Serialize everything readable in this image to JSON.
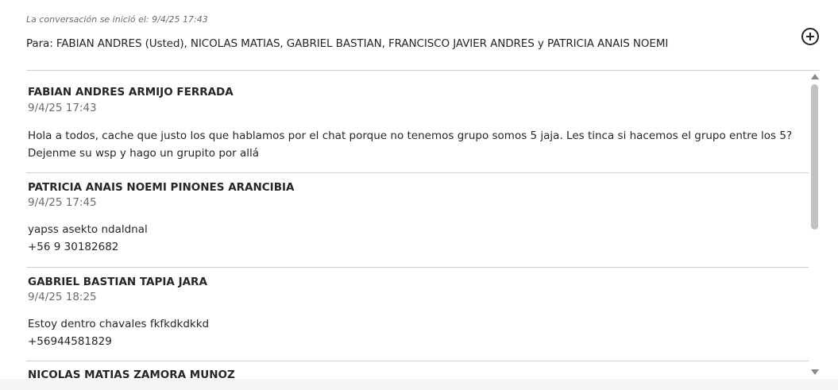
{
  "conversation": {
    "started_label": "La conversación se inició el: 9/4/25 17:43",
    "recipients": "Para: FABIAN ANDRES (Usted), NICOLAS MATIAS, GABRIEL BASTIAN, FRANCISCO JAVIER ANDRES y PATRICIA ANAIS NOEMI",
    "add_icon": "plus-circle-icon"
  },
  "messages": [
    {
      "author": "FABIAN ANDRES ARMIJO FERRADA",
      "time": "9/4/25 17:43",
      "lines": [
        "Hola a todos, cache que justo los que hablamos por el chat porque no tenemos grupo somos 5 jaja. Les tinca si hacemos el grupo entre los 5?",
        "Dejenme su wsp y hago un grupito por allá"
      ]
    },
    {
      "author": "PATRICIA ANAIS NOEMI PINONES ARANCIBIA",
      "time": "9/4/25 17:45",
      "lines": [
        "yapss asekto ndaldnal",
        "+56 9 30182682"
      ]
    },
    {
      "author": "GABRIEL BASTIAN TAPIA JARA",
      "time": "9/4/25 18:25",
      "lines": [
        "Estoy dentro chavales fkfkdkdkkd",
        "+56944581829"
      ]
    },
    {
      "author": "NICOLAS MATIAS ZAMORA MUNOZ",
      "time": "",
      "lines": []
    }
  ]
}
